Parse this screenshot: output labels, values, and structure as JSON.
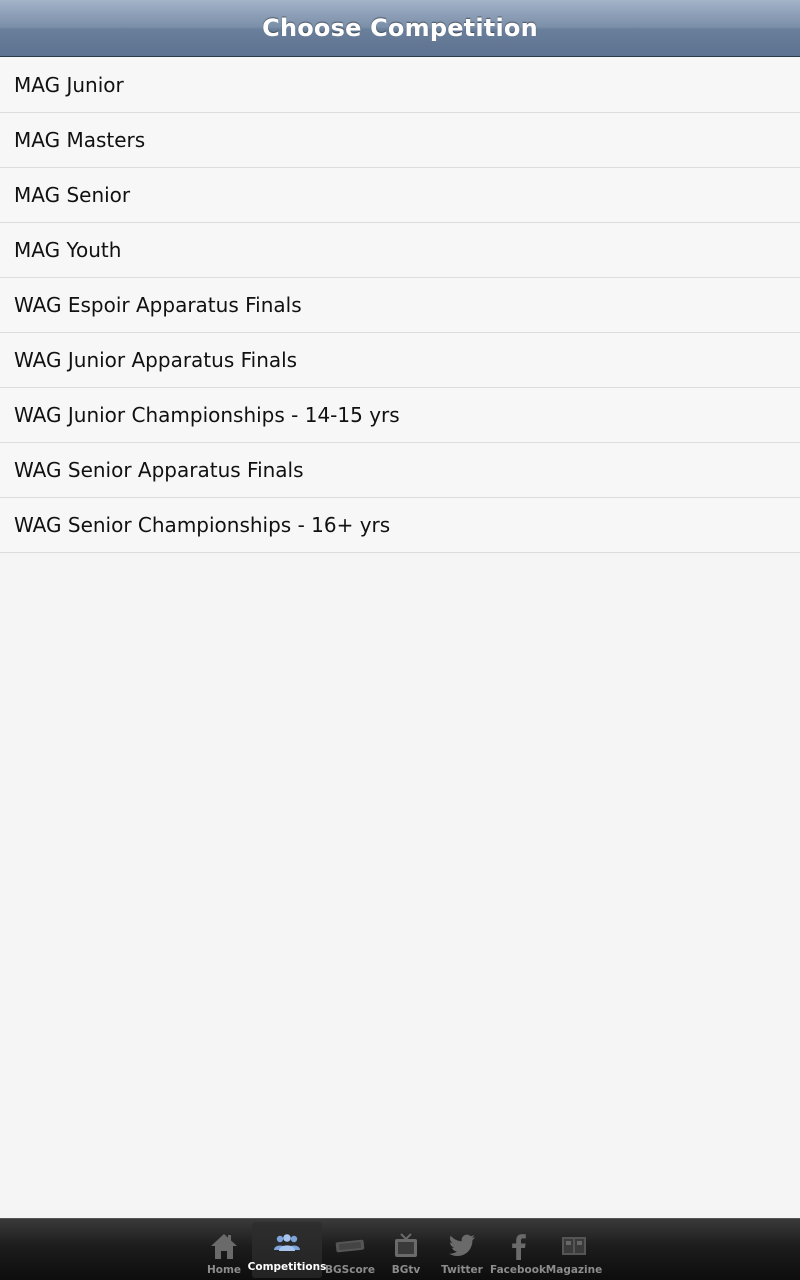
{
  "header": {
    "title": "Choose Competition"
  },
  "competitions": [
    {
      "label": "MAG Junior"
    },
    {
      "label": "MAG Masters"
    },
    {
      "label": "MAG Senior"
    },
    {
      "label": "MAG Youth"
    },
    {
      "label": "WAG Espoir Apparatus Finals"
    },
    {
      "label": "WAG Junior Apparatus Finals"
    },
    {
      "label": "WAG Junior Championships - 14-15 yrs"
    },
    {
      "label": "WAG Senior Apparatus Finals"
    },
    {
      "label": "WAG Senior Championships - 16+ yrs"
    }
  ],
  "tabbar": {
    "tabs": [
      {
        "label": "Home",
        "icon": "home-icon",
        "active": false
      },
      {
        "label": "Competitions",
        "icon": "people-icon",
        "active": true
      },
      {
        "label": "BGScore",
        "icon": "scoreboard-icon",
        "active": false
      },
      {
        "label": "BGtv",
        "icon": "tv-icon",
        "active": false
      },
      {
        "label": "Twitter",
        "icon": "twitter-bird-icon",
        "active": false
      },
      {
        "label": "Facebook",
        "icon": "facebook-icon",
        "active": false
      },
      {
        "label": "Magazine",
        "icon": "magazine-icon",
        "active": false
      }
    ]
  },
  "colors": {
    "header_top": "#a3b3c8",
    "header_bottom": "#5d7290",
    "active_icon": "#8fb2e6",
    "inactive_icon": "#666666"
  }
}
